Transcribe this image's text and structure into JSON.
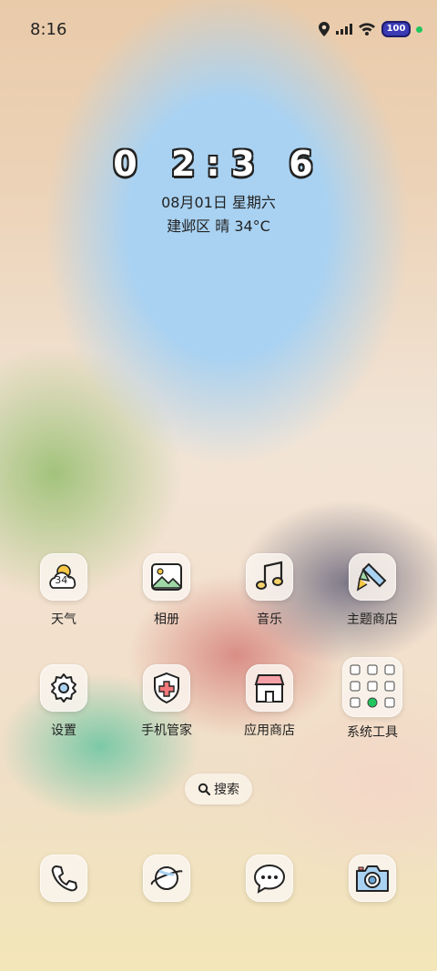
{
  "status_bar": {
    "time": "8:16",
    "battery": "100"
  },
  "clock_widget": {
    "time": "0 2:3 6",
    "date": "08月01日 星期六",
    "weather": "建邺区 晴 34°C"
  },
  "weather_icon_temp": "34°",
  "apps_row1": [
    {
      "label": "天气",
      "icon": "weather-icon"
    },
    {
      "label": "相册",
      "icon": "gallery-icon"
    },
    {
      "label": "音乐",
      "icon": "music-icon"
    },
    {
      "label": "主题商店",
      "icon": "theme-store-icon"
    }
  ],
  "apps_row2": [
    {
      "label": "设置",
      "icon": "gear-icon"
    },
    {
      "label": "手机管家",
      "icon": "phone-manager-icon"
    },
    {
      "label": "应用商店",
      "icon": "app-store-icon"
    },
    {
      "label": "系统工具",
      "icon": "system-tools-folder-icon"
    }
  ],
  "search": {
    "label": "搜索"
  },
  "dock": [
    "phone-icon",
    "browser-icon",
    "messages-icon",
    "camera-icon"
  ]
}
